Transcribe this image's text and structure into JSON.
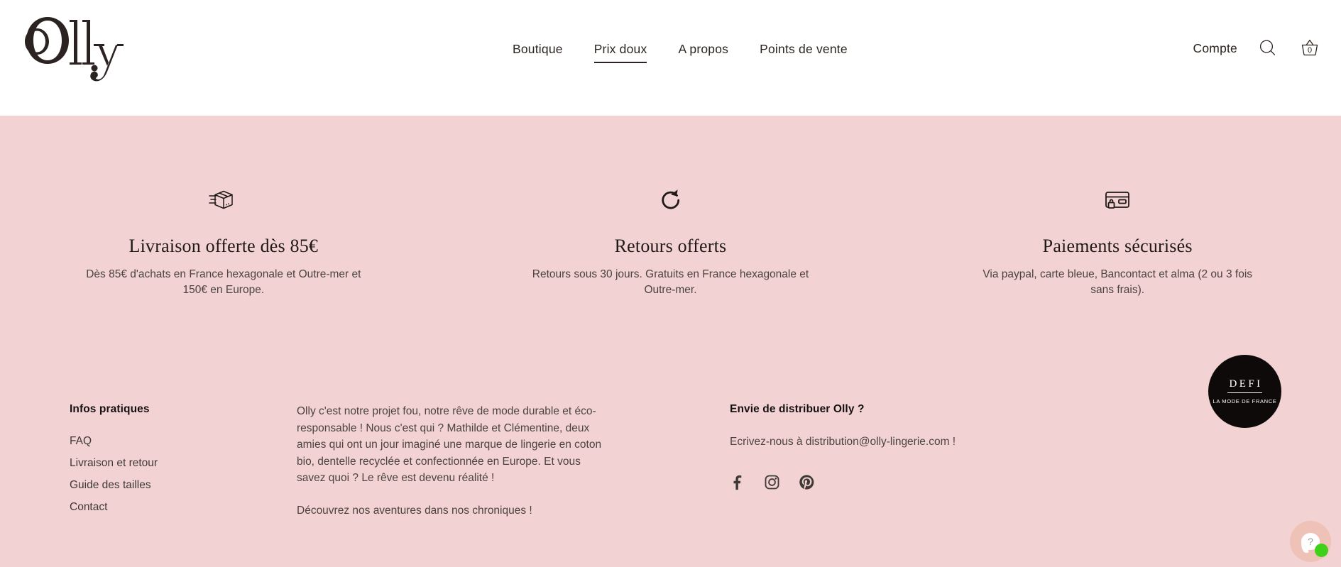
{
  "brand": {
    "logo_text": "Olly"
  },
  "header": {
    "nav": [
      {
        "label": "Boutique",
        "active": false
      },
      {
        "label": "Prix doux",
        "active": true
      },
      {
        "label": "A propos",
        "active": false
      },
      {
        "label": "Points de vente",
        "active": false
      }
    ],
    "account_label": "Compte",
    "search_icon": "search-icon",
    "cart_icon": "basket-icon",
    "cart_count": "0"
  },
  "features": [
    {
      "icon": "shipping-box-icon",
      "title": "Livraison offerte dès 85€",
      "text": "Dès 85€ d'achats en France hexagonale et Outre-mer et 150€ en Europe."
    },
    {
      "icon": "refresh-arrow-icon",
      "title": "Retours offerts",
      "text": "Retours sous 30 jours. Gratuits en France hexagonale et Outre-mer."
    },
    {
      "icon": "secure-card-icon",
      "title": "Paiements sécurisés",
      "text": "Via paypal, carte bleue, Bancontact et alma (2 ou 3 fois sans frais)."
    }
  ],
  "footer": {
    "infos": {
      "heading": "Infos pratiques",
      "links": [
        "FAQ",
        "Livraison et retour",
        "Guide des tailles",
        "Contact"
      ]
    },
    "about": {
      "paragraph1": "Olly c'est notre projet fou, notre rêve de mode durable et éco-responsable ! Nous c'est qui ? Mathilde et Clémentine, deux amies qui ont un jour imaginé  une marque de lingerie en coton bio, dentelle recyclée et confectionnée en Europe. Et vous savez quoi ? Le rêve est devenu réalité !",
      "paragraph2": "Découvrez nos aventures dans nos chroniques !"
    },
    "distribution": {
      "heading": "Envie de distribuer Olly ?",
      "text": "Ecrivez-nous à distribution@olly-lingerie.com !",
      "social": [
        "facebook-icon",
        "instagram-icon",
        "pinterest-icon"
      ]
    }
  },
  "defi_badge": {
    "title": "DEFI",
    "subtitle": "LA MODE DE FRANCE"
  },
  "chat_widget": {
    "icon": "question-bubble-icon",
    "status": "online"
  },
  "colors": {
    "pink_background": "#F2D2D2",
    "header_background": "#FFFFFF",
    "text_dark": "#2C2420",
    "badge_background": "#0D0A09",
    "status_green": "#3FD11A"
  }
}
